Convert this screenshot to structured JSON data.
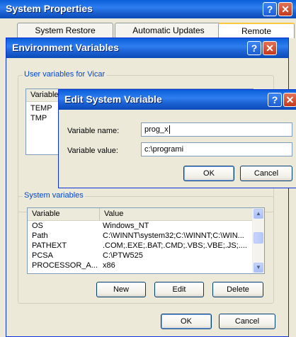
{
  "system_properties": {
    "title": "System Properties",
    "tabs": [
      "System Restore",
      "Automatic Updates",
      "Remote"
    ],
    "help_glyph": "?",
    "close_glyph": "✕"
  },
  "environment_variables": {
    "title": "Environment Variables",
    "user_group": {
      "legend": "User variables for Vicar",
      "column": "Variable",
      "rows": [
        "TEMP",
        "TMP"
      ]
    },
    "system_group": {
      "legend": "System variables",
      "columns": [
        "Variable",
        "Value"
      ],
      "rows": [
        {
          "variable": "OS",
          "value": "Windows_NT"
        },
        {
          "variable": "Path",
          "value": "C:\\WINNT\\system32;C:\\WINNT;C:\\WIN..."
        },
        {
          "variable": "PATHEXT",
          "value": ".COM;.EXE;.BAT;.CMD;.VBS;.VBE;.JS;...."
        },
        {
          "variable": "PCSA",
          "value": "C:\\PTW525"
        },
        {
          "variable": "PROCESSOR_A...",
          "value": "x86"
        }
      ],
      "buttons": {
        "new": "New",
        "edit": "Edit",
        "delete": "Delete"
      }
    },
    "buttons": {
      "ok": "OK",
      "cancel": "Cancel"
    }
  },
  "edit_system_variable": {
    "title": "Edit System Variable",
    "name_label": "Variable name:",
    "name_value": "prog_x",
    "value_label": "Variable value:",
    "value_value": "c:\\programi",
    "ok": "OK",
    "cancel": "Cancel"
  }
}
